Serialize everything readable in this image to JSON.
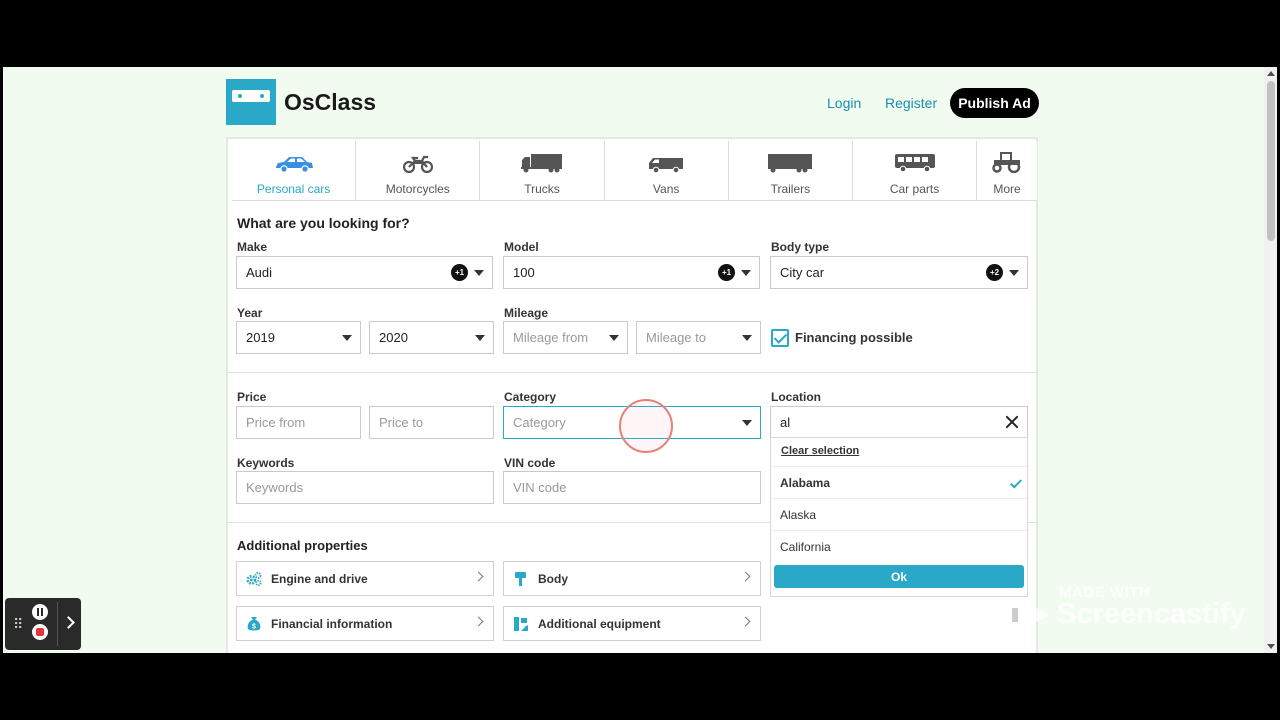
{
  "header": {
    "logo_text": "OsClass",
    "login": "Login",
    "register": "Register",
    "publish": "Publish Ad"
  },
  "tabs": [
    {
      "label": "Personal cars",
      "icon": "car-icon",
      "active": true
    },
    {
      "label": "Motorcycles",
      "icon": "motorcycle-icon",
      "active": false
    },
    {
      "label": "Trucks",
      "icon": "truck-icon",
      "active": false
    },
    {
      "label": "Vans",
      "icon": "van-icon",
      "active": false
    },
    {
      "label": "Trailers",
      "icon": "trailer-icon",
      "active": false
    },
    {
      "label": "Car parts",
      "icon": "bus-icon",
      "active": false
    },
    {
      "label": "More",
      "icon": "tractor-icon",
      "active": false
    }
  ],
  "search": {
    "title": "What are you looking for?",
    "make": {
      "label": "Make",
      "value": "Audi",
      "badge": "+1"
    },
    "model": {
      "label": "Model",
      "value": "100",
      "badge": "+1"
    },
    "body_type": {
      "label": "Body type",
      "value": "City car",
      "badge": "+2"
    },
    "year": {
      "label": "Year",
      "from": "2019",
      "to": "2020"
    },
    "mileage": {
      "label": "Mileage",
      "from_placeholder": "Mileage from",
      "to_placeholder": "Mileage to"
    },
    "financing": {
      "label": "Financing possible",
      "checked": true
    },
    "price": {
      "label": "Price",
      "from_placeholder": "Price from",
      "to_placeholder": "Price to"
    },
    "category": {
      "label": "Category",
      "placeholder": "Category"
    },
    "location": {
      "label": "Location",
      "value": "al"
    },
    "keywords": {
      "label": "Keywords",
      "placeholder": "Keywords"
    },
    "vin": {
      "label": "VIN code",
      "placeholder": "VIN code"
    }
  },
  "location_dropdown": {
    "clear": "Clear selection",
    "options": [
      {
        "label": "Alabama",
        "selected": true
      },
      {
        "label": "Alaska",
        "selected": false
      },
      {
        "label": "California",
        "selected": false
      }
    ],
    "ok": "Ok"
  },
  "additional": {
    "title": "Additional properties",
    "items": [
      {
        "label": "Engine and drive",
        "icon": "gears-icon"
      },
      {
        "label": "Body",
        "icon": "paint-roller-icon"
      },
      {
        "label": "Financial information",
        "icon": "money-bag-icon"
      },
      {
        "label": "Additional equipment",
        "icon": "equipment-icon"
      }
    ]
  },
  "watermark": {
    "made_with": "MADE WITH",
    "brand": "Screencastify"
  },
  "colors": {
    "accent": "#29a9c7",
    "page_bg": "#f2fbef",
    "dark": "#000000"
  }
}
